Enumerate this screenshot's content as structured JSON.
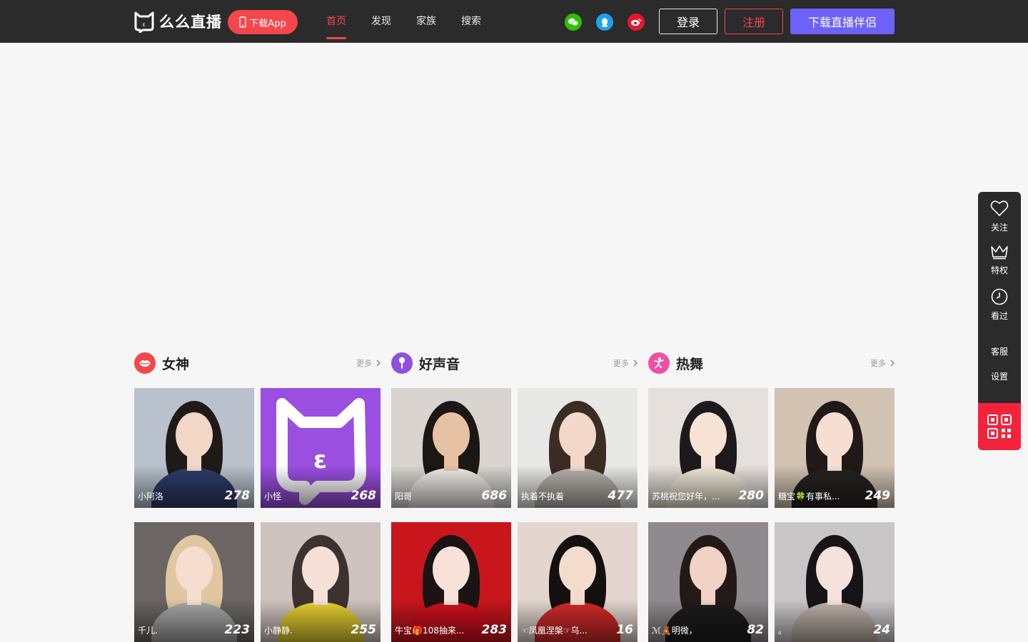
{
  "header": {
    "logo_text": "么么直播",
    "download_app": "下载App",
    "nav": [
      {
        "label": "首页",
        "active": true
      },
      {
        "label": "发现",
        "active": false
      },
      {
        "label": "家族",
        "active": false
      },
      {
        "label": "搜索",
        "active": false
      }
    ],
    "social": [
      {
        "icon": "wechat-icon",
        "color": "#2dc100"
      },
      {
        "icon": "qq-icon",
        "color": "#1ea1f1"
      },
      {
        "icon": "weibo-icon",
        "color": "#e6162d"
      }
    ],
    "login": "登录",
    "register": "注册",
    "download_companion": "下载直播伴侣"
  },
  "colors": {
    "accent": "#f4474b",
    "purple": "#6d62f7",
    "header_bg": "#2b2b2b"
  },
  "sections": [
    {
      "title": "女神",
      "more": "更多",
      "icon": "lips-icon",
      "icon_color": "#f4474b",
      "cards": [
        {
          "name": "小阿洛",
          "count": "278",
          "bg": "#b9c2cc",
          "skin": "#f2d6c6",
          "hair": "#1f1a18",
          "cloth": "#2e3d6b"
        },
        {
          "name": "小怪",
          "count": "268",
          "bg": "#9a4fe0",
          "logo": true
        },
        {
          "name": "千儿.",
          "count": "223",
          "bg": "#6b6663",
          "skin": "#f5ddd0",
          "hair": "#e0c7a0",
          "cloth": "#a8a8a8"
        },
        {
          "name": "小静静.",
          "count": "255",
          "bg": "#cfc3bf",
          "skin": "#f6e0d8",
          "hair": "#3d3230",
          "cloth": "#e8d230"
        }
      ]
    },
    {
      "title": "好声音",
      "more": "更多",
      "icon": "microphone-icon",
      "icon_color": "#8e4fe3",
      "cards": [
        {
          "name": "阳哥",
          "count": "686",
          "bg": "#d9d4cf",
          "skin": "#e7c1a3",
          "hair": "#1b1714",
          "cloth": "#f1eee8"
        },
        {
          "name": "执着不执着",
          "count": "477",
          "bg": "#e8e8e6",
          "skin": "#f3d8c9",
          "hair": "#3b2c24",
          "cloth": "#b7b3ad"
        },
        {
          "name": "牛宝🎁108抽来...",
          "count": "283",
          "bg": "#c8161c",
          "skin": "#f7e1d8",
          "hair": "#1a1414",
          "cloth": "#d0101c"
        },
        {
          "name": "☜凤凰涅槃☞乌...",
          "count": "16",
          "bg": "#e4d6cf",
          "skin": "#f4dccd",
          "hair": "#141010",
          "cloth": "#d42a2a"
        }
      ]
    },
    {
      "title": "热舞",
      "more": "更多",
      "icon": "dancer-icon",
      "icon_color": "#ee4fa1",
      "cards": [
        {
          "name": "苏桃祝您好年，...",
          "count": "280",
          "bg": "#e6e0dc",
          "skin": "#f7e2d6",
          "hair": "#1c1a1c",
          "cloth": "#f0ead8"
        },
        {
          "name": "糖宝🍀有事私...",
          "count": "249",
          "bg": "#d2c3b2",
          "skin": "#f6dfd2",
          "hair": "#211918",
          "cloth": "#262222"
        },
        {
          "name": "ℳ🧸明微，",
          "count": "82",
          "bg": "#8f8a8d",
          "skin": "#f1d2c4",
          "hair": "#231a18",
          "cloth": "#1e1c1d"
        },
        {
          "name": "。",
          "count": "24",
          "bg": "#c9c6c8",
          "skin": "#f5e2dc",
          "hair": "#161416",
          "cloth": "#bfb2aa"
        }
      ]
    }
  ],
  "sidebar": [
    {
      "label": "关注",
      "icon": "heart-icon"
    },
    {
      "label": "特权",
      "icon": "crown-icon"
    },
    {
      "label": "看过",
      "icon": "clock-icon"
    },
    {
      "label": "客服",
      "icon": ""
    },
    {
      "label": "设置",
      "icon": ""
    }
  ],
  "sidebar_qr_icon": "qrcode-icon"
}
